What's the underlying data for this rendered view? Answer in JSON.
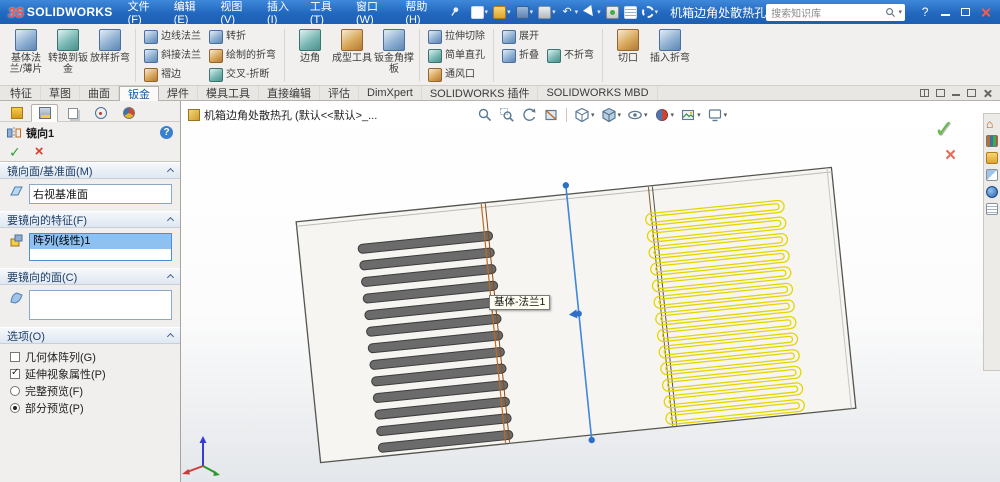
{
  "titlebar": {
    "logo_badge": "3S",
    "logo_text": "SOLIDWORKS",
    "menus": [
      "文件(F)",
      "编辑(E)",
      "视图(V)",
      "插入(I)",
      "工具(T)",
      "窗口(W)",
      "帮助(H)"
    ],
    "quick_access_icons": [
      "new-document",
      "open",
      "save",
      "print",
      "undo",
      "select",
      "rebuild",
      "file-properties",
      "options"
    ],
    "doc_title": "机箱边角处散热孔",
    "search_placeholder": "搜索知识库",
    "help_glyph": "?"
  },
  "ribbon": {
    "groups": [
      {
        "buttons": [
          {
            "label": "基体法兰/薄片"
          },
          {
            "label": "转换到钣金"
          },
          {
            "label": "放样折弯"
          }
        ]
      },
      {
        "buttons": [
          {
            "label": "边线法兰"
          },
          {
            "label": "斜接法兰"
          },
          {
            "label": "褶边"
          }
        ]
      },
      {
        "buttons": [
          {
            "label": "转折"
          },
          {
            "label": "绘制的折弯"
          },
          {
            "label": "交叉-折断"
          }
        ]
      },
      {
        "buttons": [
          {
            "label": "边角"
          },
          {
            "label": "成型工具"
          },
          {
            "label": "钣金角撑板"
          }
        ]
      },
      {
        "buttons": [
          {
            "label": "拉伸切除"
          },
          {
            "label": "简单直孔"
          },
          {
            "label": "通风口"
          }
        ]
      },
      {
        "buttons": [
          {
            "label": "展开"
          },
          {
            "label": "折叠"
          }
        ]
      },
      {
        "buttons": [
          {
            "label": "不折弯"
          }
        ]
      },
      {
        "buttons": [
          {
            "label": "切口"
          },
          {
            "label": "插入折弯"
          }
        ]
      }
    ]
  },
  "command_tabs": {
    "items": [
      "特征",
      "草图",
      "曲面",
      "钣金",
      "焊件",
      "模具工具",
      "直接编辑",
      "评估",
      "DimXpert",
      "SOLIDWORKS 插件",
      "SOLIDWORKS MBD"
    ],
    "active": "钣金"
  },
  "property_manager": {
    "title": "镜向1",
    "help_glyph": "?",
    "ok_glyph": "✓",
    "cancel_glyph": "×",
    "sections": {
      "mirror_plane": {
        "header": "镜向面/基准面(M)",
        "value": "右视基准面"
      },
      "features": {
        "header": "要镜向的特征(F)",
        "selected_item": "阵列(线性)1"
      },
      "faces": {
        "header": "要镜向的面(C)",
        "value": ""
      },
      "options": {
        "header": "选项(O)",
        "geometry_pattern": {
          "label": "几何体阵列(G)",
          "checked": false
        },
        "propagate_visual": {
          "label": "延伸视象属性(P)",
          "checked": true
        },
        "full_preview": {
          "label": "完整预览(F)",
          "selected": false
        },
        "partial_preview": {
          "label": "部分预览(P)",
          "selected": true
        }
      }
    }
  },
  "viewport": {
    "tree_label": "机箱边角处散热孔 (默认<<默认>_...",
    "part_callout": "基体-法兰1",
    "confirm_ok_glyph": "✓",
    "confirm_cancel_glyph": "×",
    "headsup_icons": [
      "zoom-fit",
      "zoom-area",
      "previous-view",
      "section-view",
      "view-orientation",
      "display-style",
      "hide-show-items",
      "edit-appearance",
      "apply-scene",
      "view-settings"
    ],
    "task_pane_icons": [
      "solidworks-resources",
      "design-library",
      "file-explorer",
      "view-palette",
      "appearances-scenes",
      "custom-properties"
    ]
  },
  "colors": {
    "titlebar_blue": "#2268be",
    "selection_blue": "#8fc1f0",
    "preview_yellow": "#e3d600",
    "mirror_line_blue": "#3f87d9",
    "bend_line_orange": "#c2691e"
  }
}
